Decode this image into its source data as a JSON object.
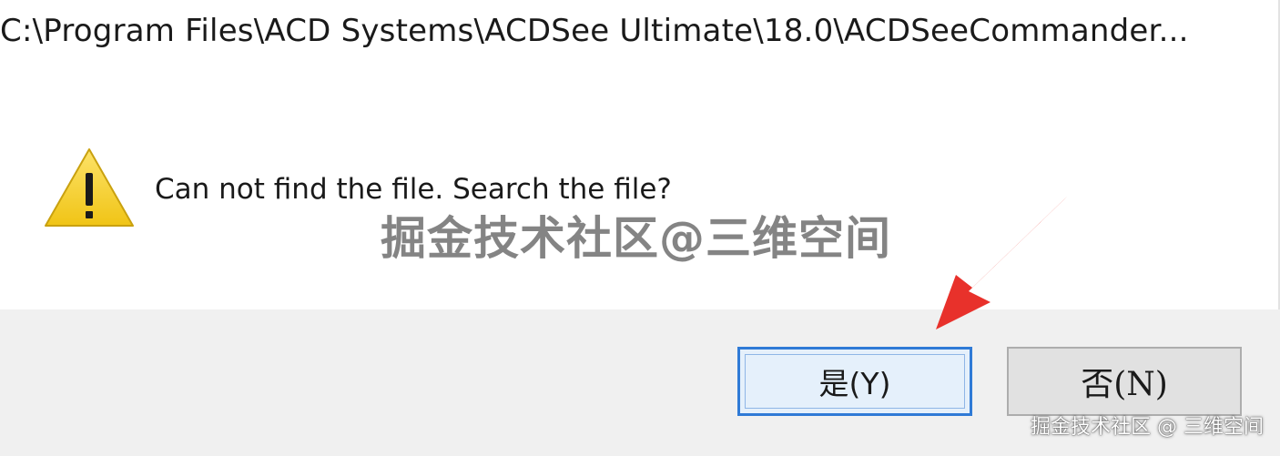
{
  "dialog": {
    "title_path": "C:\\Program Files\\ACD Systems\\ACDSee Ultimate\\18.0\\ACDSeeCommander...",
    "message": "Can not find the file. Search the file?",
    "icon": "warning-icon",
    "buttons": {
      "yes_label": "是(Y)",
      "no_label": "否(N)"
    }
  },
  "watermarks": {
    "center": "掘金技术社区@三维空间",
    "corner": "掘金技术社区 @ 三维空间"
  },
  "colors": {
    "accent": "#2f7ad6",
    "warning": "#f2c81b",
    "arrow": "#e8312b",
    "footer_bg": "#f0f0f0"
  }
}
